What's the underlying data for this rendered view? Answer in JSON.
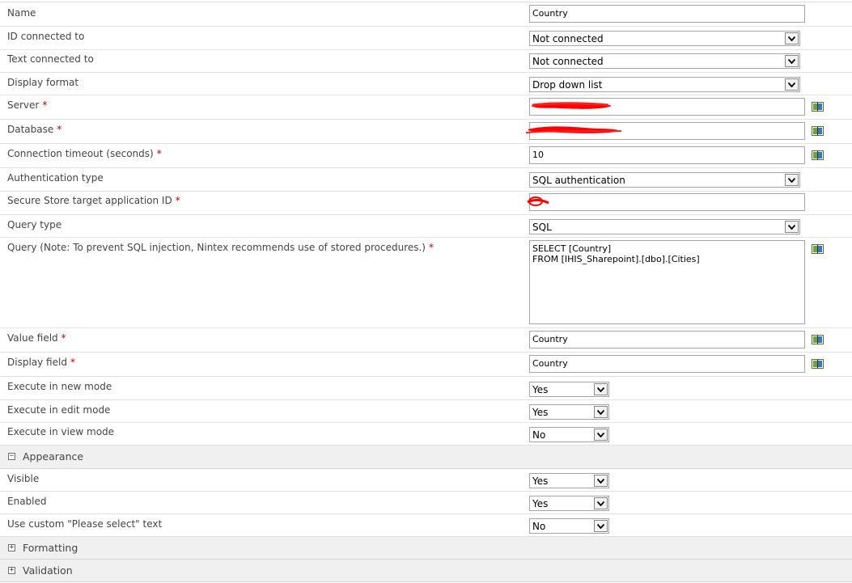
{
  "rows": {
    "name": {
      "label": "Name",
      "value": "Country"
    },
    "id_connected_to": {
      "label": "ID connected to",
      "value": "Not connected"
    },
    "text_connected_to": {
      "label": "Text connected to",
      "value": "Not connected"
    },
    "display_format": {
      "label": "Display format",
      "value": "Drop down list"
    },
    "server": {
      "label": "Server",
      "required": "*",
      "value": ""
    },
    "database": {
      "label": "Database",
      "required": "*",
      "value": ""
    },
    "connection_timeout": {
      "label": "Connection timeout (seconds)",
      "required": "*",
      "value": "10"
    },
    "authentication_type": {
      "label": "Authentication type",
      "value": "SQL authentication"
    },
    "secure_store": {
      "label": "Secure Store target application ID",
      "required": "*",
      "value": ""
    },
    "query_type": {
      "label": "Query type",
      "value": "SQL"
    },
    "query": {
      "label": "Query (Note: To prevent SQL injection, Nintex recommends use of stored procedures.)",
      "required": "*",
      "value": "SELECT [Country]\nFROM [IHIS_Sharepoint].[dbo].[Cities]"
    },
    "value_field": {
      "label": "Value field",
      "required": "*",
      "value": "Country"
    },
    "display_field": {
      "label": "Display field",
      "required": "*",
      "value": "Country"
    },
    "execute_new": {
      "label": "Execute in new mode",
      "value": "Yes"
    },
    "execute_edit": {
      "label": "Execute in edit mode",
      "value": "Yes"
    },
    "execute_view": {
      "label": "Execute in view mode",
      "value": "No"
    },
    "visible": {
      "label": "Visible",
      "value": "Yes"
    },
    "enabled": {
      "label": "Enabled",
      "value": "Yes"
    },
    "custom_please_select": {
      "label": "Use custom \"Please select\" text",
      "value": "No"
    }
  },
  "sections": {
    "appearance": {
      "title": "Appearance",
      "toggle": "−",
      "expanded": true
    },
    "formatting": {
      "title": "Formatting",
      "toggle": "+",
      "expanded": false
    },
    "validation": {
      "title": "Validation",
      "toggle": "+",
      "expanded": false
    }
  },
  "icons": {
    "lookup": "lookup-book-icon",
    "dropdown": "chevron-down-icon",
    "section_toggle": "expand-collapse-icon"
  },
  "colors": {
    "required": "#c00000",
    "section_bg": "#f0f0f0",
    "border": "#a5a5a5",
    "redaction": "#ff0000"
  }
}
